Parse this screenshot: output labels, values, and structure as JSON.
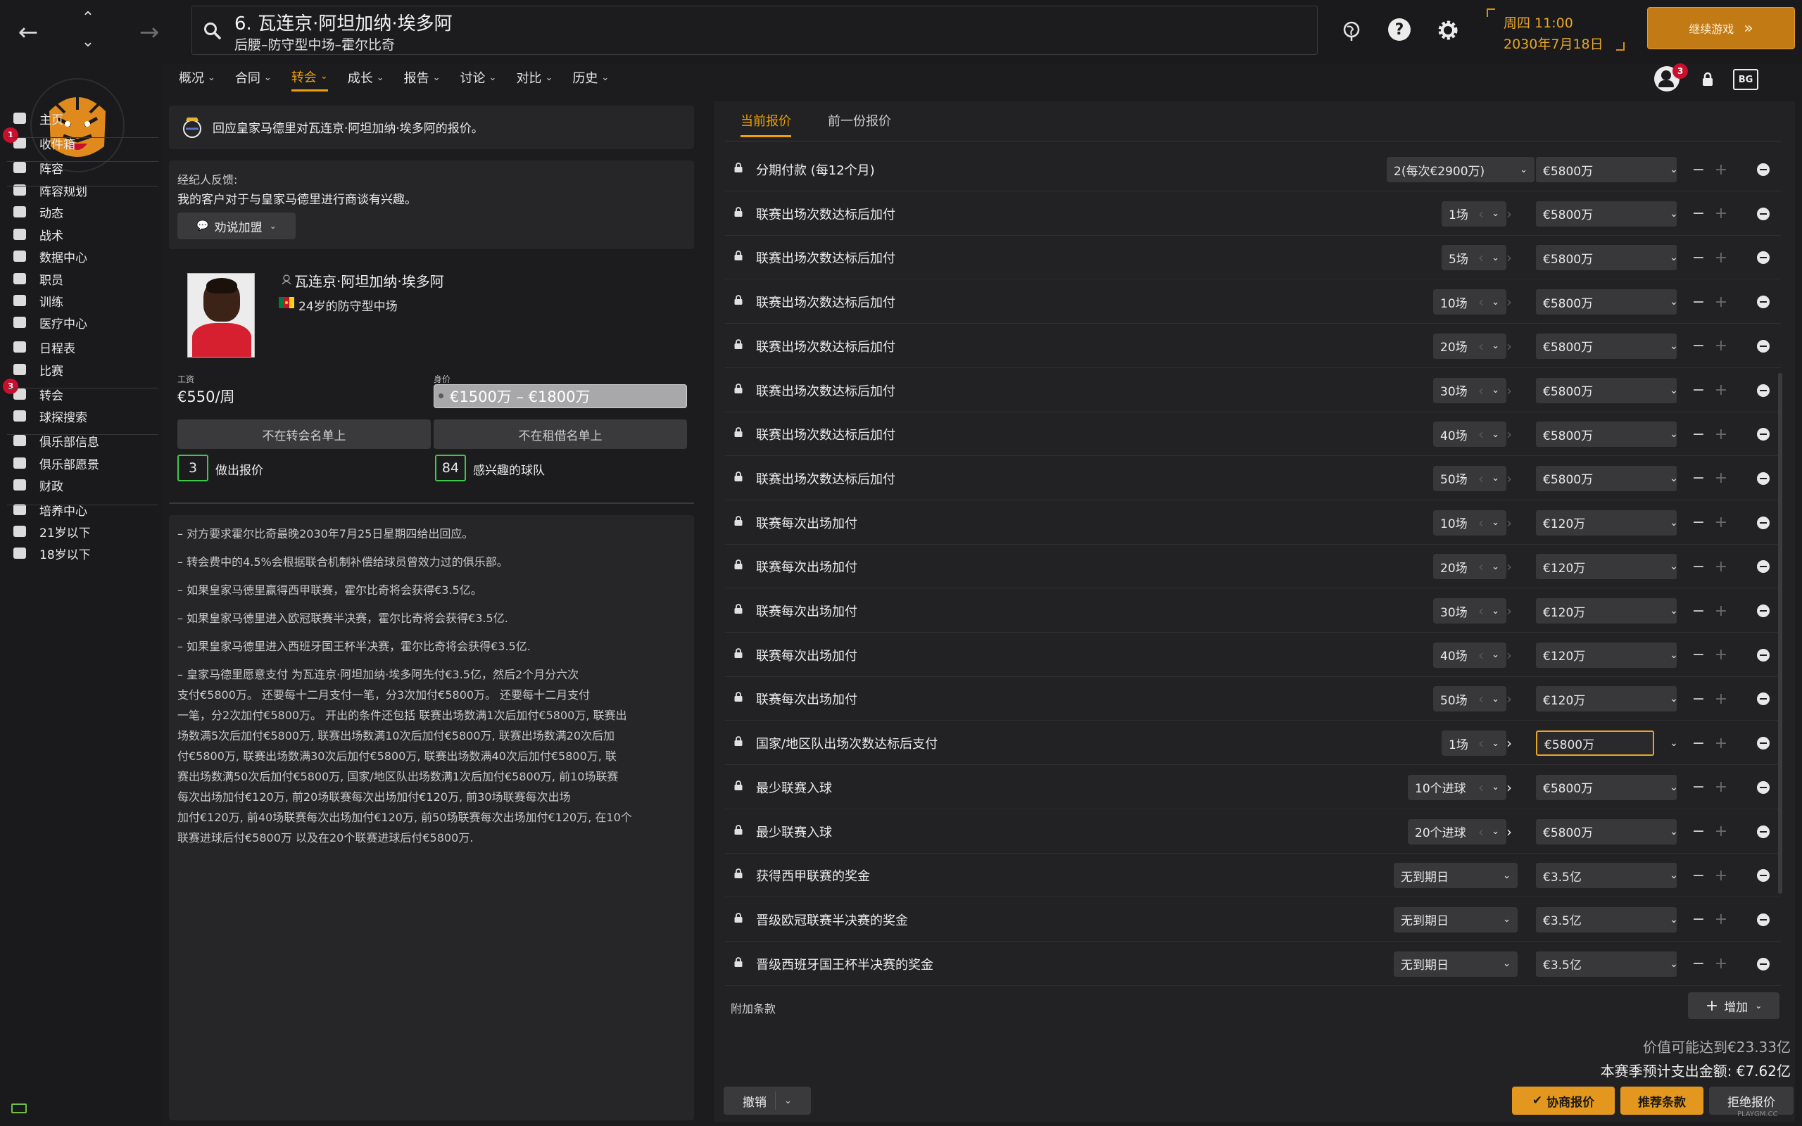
{
  "header": {
    "player_title": "6. 瓦连京·阿坦加纳·埃多阿",
    "player_subtitle": "后腰–防守型中场–霍尔比奇",
    "date_line1": "周四 11:00",
    "date_line2": "2030年7月18日",
    "continue_label": "继续游戏",
    "continue_icon": "»",
    "back_icon": "←",
    "forward_icon": "→",
    "up_icon": "⌃",
    "down_icon": "⌄",
    "search_icon": "search-icon",
    "help_label": "?",
    "notification_count": "3",
    "bg_label": "BG"
  },
  "nav": [
    {
      "label": "概况",
      "active": false
    },
    {
      "label": "合同",
      "active": false
    },
    {
      "label": "转会",
      "active": true
    },
    {
      "label": "成长",
      "active": false
    },
    {
      "label": "报告",
      "active": false
    },
    {
      "label": "讨论",
      "active": false
    },
    {
      "label": "对比",
      "active": false
    },
    {
      "label": "历史",
      "active": false
    }
  ],
  "sidebar": {
    "items": [
      {
        "label": "主页",
        "icon": "home-icon"
      },
      {
        "label": "收件箱",
        "icon": "inbox-icon",
        "badge": "1"
      },
      {
        "label": "阵容",
        "icon": "shirt-icon"
      },
      {
        "label": "阵容规划",
        "icon": "clipboard-icon"
      },
      {
        "label": "动态",
        "icon": "dynamics-icon"
      },
      {
        "label": "战术",
        "icon": "tactics-icon"
      },
      {
        "label": "数据中心",
        "icon": "data-hub-icon"
      },
      {
        "label": "职员",
        "icon": "staff-icon"
      },
      {
        "label": "训练",
        "icon": "training-icon"
      },
      {
        "label": "医疗中心",
        "icon": "medical-icon"
      },
      {
        "label": "日程表",
        "icon": "calendar-icon"
      },
      {
        "label": "比赛",
        "icon": "trophy-icon"
      },
      {
        "label": "转会",
        "icon": "transfer-icon",
        "badge": "3"
      },
      {
        "label": "球探搜索",
        "icon": "scouting-icon"
      },
      {
        "label": "俱乐部信息",
        "icon": "shield-icon"
      },
      {
        "label": "俱乐部愿景",
        "icon": "vision-icon"
      },
      {
        "label": "财政",
        "icon": "finance-icon"
      },
      {
        "label": "培养中心",
        "icon": "development-icon"
      },
      {
        "label": "21岁以下",
        "icon": "u21-icon"
      },
      {
        "label": "18岁以下",
        "icon": "u18-icon"
      }
    ]
  },
  "left": {
    "response_text": "回应皇家马德里对瓦连京·阿坦加纳·埃多阿的报价。",
    "agent_label": "经纪人反馈:",
    "agent_text": "我的客户对于与皇家马德里进行商谈有兴趣。",
    "persuade_label": "劝说加盟",
    "player_name": "瓦连京·阿坦加纳·埃多阿",
    "player_desc": "24岁的防守型中场",
    "wage_label": "工资",
    "wage_value": "€550/周",
    "value_label": "身价",
    "value_value": "€1500万 – €1800万",
    "not_transfer": "不在转会名单上",
    "not_loan": "不在租借名单上",
    "offers_count": "3",
    "offers_label": "做出报价",
    "interested_count": "84",
    "interested_label": "感兴趣的球队",
    "notes": [
      "– 对方要求霍尔比奇最晚2030年7月25日星期四给出回应。",
      "– 转会费中的4.5%会根据联合机制补偿给球员曾效力过的俱乐部。",
      "– 如果皇家马德里赢得西甲联赛，霍尔比奇将会获得€3.5亿。",
      "– 如果皇家马德里进入欧冠联赛半决赛，霍尔比奇将会获得€3.5亿.",
      "– 如果皇家马德里进入西班牙国王杯半决赛，霍尔比奇将会获得€3.5亿."
    ],
    "summary_lines": [
      "– 皇家马德里愿意支付 为瓦连京·阿坦加纳·埃多阿先付€3.5亿，然后2个月分六次",
      "支付€5800万。 还要每十二月支付一笔，分3次加付€5800万。 还要每十二月支付",
      "一笔，分2次加付€5800万。 开出的条件还包括 联赛出场数满1次后加付€5800万, 联赛出",
      "场数满5次后加付€5800万, 联赛出场数满10次后加付€5800万, 联赛出场数满20次后加",
      "付€5800万, 联赛出场数满30次后加付€5800万, 联赛出场数满40次后加付€5800万, 联",
      "赛出场数满50次后加付€5800万, 国家/地区队出场数满1次后加付€5800万, 前10场联赛",
      "每次出场加付€120万, 前20场联赛每次出场加付€120万, 前30场联赛每次出场",
      "加付€120万, 前40场联赛每次出场加付€120万, 前50场联赛每次出场加付€120万, 在10个",
      "联赛进球后付€5800万 以及在20个联赛进球后付€5800万."
    ]
  },
  "right": {
    "tabs": [
      {
        "label": "当前报价",
        "active": true
      },
      {
        "label": "前一份报价",
        "active": false
      }
    ],
    "clauses": [
      {
        "label": "分期付款 (每12个月)",
        "option": "2(每次€2900万)",
        "amount": "€5800万",
        "arrows": false,
        "right_on": false
      },
      {
        "label": "联赛出场次数达标后加付",
        "option": "1场",
        "amount": "€5800万",
        "arrows": true,
        "right_on": false
      },
      {
        "label": "联赛出场次数达标后加付",
        "option": "5场",
        "amount": "€5800万",
        "arrows": true,
        "right_on": false
      },
      {
        "label": "联赛出场次数达标后加付",
        "option": "10场",
        "amount": "€5800万",
        "arrows": true,
        "right_on": false
      },
      {
        "label": "联赛出场次数达标后加付",
        "option": "20场",
        "amount": "€5800万",
        "arrows": true,
        "right_on": false
      },
      {
        "label": "联赛出场次数达标后加付",
        "option": "30场",
        "amount": "€5800万",
        "arrows": true,
        "right_on": false
      },
      {
        "label": "联赛出场次数达标后加付",
        "option": "40场",
        "amount": "€5800万",
        "arrows": true,
        "right_on": false
      },
      {
        "label": "联赛出场次数达标后加付",
        "option": "50场",
        "amount": "€5800万",
        "arrows": true,
        "right_on": false
      },
      {
        "label": "联赛每次出场加付",
        "option": "10场",
        "amount": "€120万",
        "arrows": true,
        "right_on": false
      },
      {
        "label": "联赛每次出场加付",
        "option": "20场",
        "amount": "€120万",
        "arrows": true,
        "right_on": false
      },
      {
        "label": "联赛每次出场加付",
        "option": "30场",
        "amount": "€120万",
        "arrows": true,
        "right_on": false
      },
      {
        "label": "联赛每次出场加付",
        "option": "40场",
        "amount": "€120万",
        "arrows": true,
        "right_on": false
      },
      {
        "label": "联赛每次出场加付",
        "option": "50场",
        "amount": "€120万",
        "arrows": true,
        "right_on": false
      },
      {
        "label": "国家/地区队出场次数达标后支付",
        "option": "1场",
        "amount": "€5800万",
        "arrows": true,
        "right_on": true,
        "focus": true
      },
      {
        "label": "最少联赛入球",
        "option": "10个进球",
        "amount": "€5800万",
        "arrows": true,
        "right_on": true
      },
      {
        "label": "最少联赛入球",
        "option": "20个进球",
        "amount": "€5800万",
        "arrows": true,
        "right_on": true
      },
      {
        "label": "获得西甲联赛的奖金",
        "option": "无到期日",
        "amount": "€3.5亿",
        "arrows": false,
        "right_on": false
      },
      {
        "label": "晋级欧冠联赛半决赛的奖金",
        "option": "无到期日",
        "amount": "€3.5亿",
        "arrows": false,
        "right_on": false
      },
      {
        "label": "晋级西班牙国王杯半决赛的奖金",
        "option": "无到期日",
        "amount": "€3.5亿",
        "arrows": false,
        "right_on": false
      }
    ],
    "extra_label": "附加条款",
    "add_label": "增加",
    "potential_value": "价值可能达到€23.33亿",
    "season_spend": "本赛季预计支出金额: €7.62亿",
    "undo_label": "撤销",
    "negotiate_label": "协商报价",
    "suggest_label": "推荐条款",
    "reject_label": "拒绝报价",
    "watermark": "PLAYGM.CC"
  },
  "colors": {
    "accent": "#f0a000",
    "continue_bg": "#c27a15",
    "green": "#3ec94a",
    "badge": "#c8102e"
  }
}
